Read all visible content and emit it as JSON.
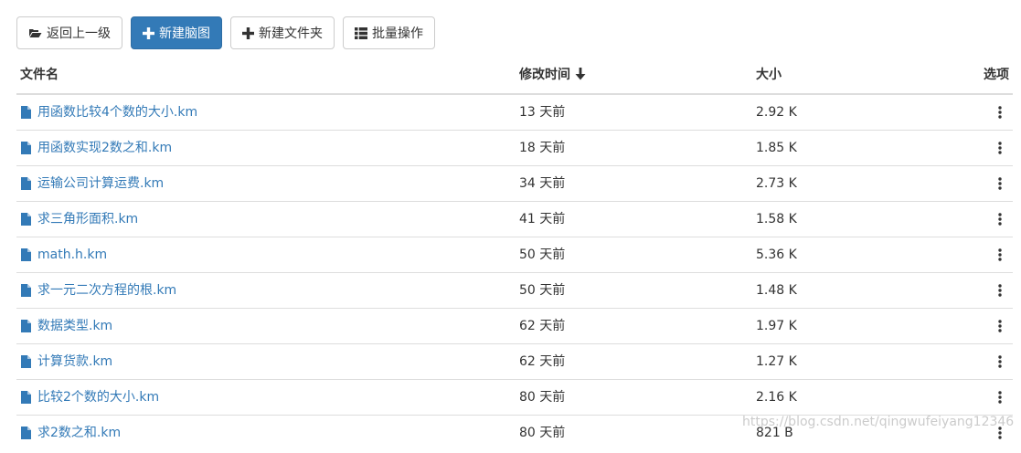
{
  "toolbar": {
    "back_label": "返回上一级",
    "new_mindmap_label": "新建脑图",
    "new_folder_label": "新建文件夹",
    "batch_label": "批量操作"
  },
  "columns": {
    "name": "文件名",
    "modified": "修改时间",
    "size": "大小",
    "options": "选项"
  },
  "files": [
    {
      "name": "用函数比较4个数的大小.km",
      "modified": "13 天前",
      "size": "2.92 K"
    },
    {
      "name": "用函数实现2数之和.km",
      "modified": "18 天前",
      "size": "1.85 K"
    },
    {
      "name": "运输公司计算运费.km",
      "modified": "34 天前",
      "size": "2.73 K"
    },
    {
      "name": "求三角形面积.km",
      "modified": "41 天前",
      "size": "1.58 K"
    },
    {
      "name": "math.h.km",
      "modified": "50 天前",
      "size": "5.36 K"
    },
    {
      "name": "求一元二次方程的根.km",
      "modified": "50 天前",
      "size": "1.48 K"
    },
    {
      "name": "数据类型.km",
      "modified": "62 天前",
      "size": "1.97 K"
    },
    {
      "name": "计算货款.km",
      "modified": "62 天前",
      "size": "1.27 K"
    },
    {
      "name": "比较2个数的大小.km",
      "modified": "80 天前",
      "size": "2.16 K"
    },
    {
      "name": "求2数之和.km",
      "modified": "80 天前",
      "size": "821 B"
    }
  ],
  "watermark": "https://blog.csdn.net/qingwufeiyang12346",
  "colors": {
    "primary": "#337ab7",
    "link": "#337ab7",
    "border": "#dddddd"
  },
  "icons": {
    "back": "folder-open-icon",
    "new_mindmap": "plus-icon",
    "new_folder": "plus-icon",
    "batch": "list-icon",
    "file": "file-icon",
    "sort": "arrow-down-icon",
    "options": "vertical-ellipsis-icon"
  }
}
